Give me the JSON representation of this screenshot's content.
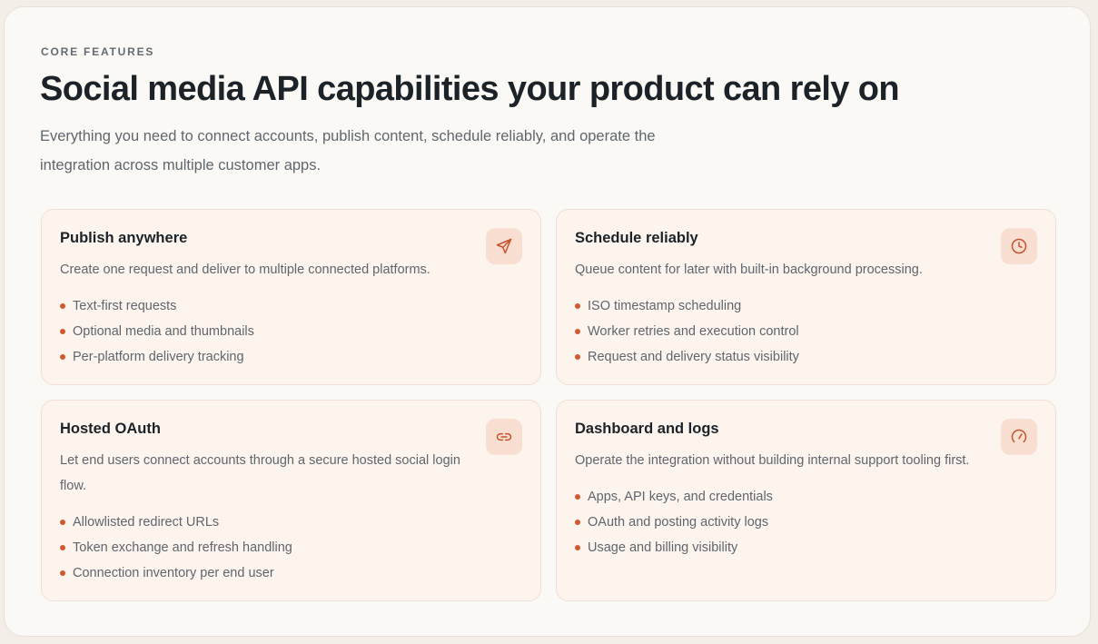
{
  "section": {
    "eyebrow": "CORE FEATURES",
    "title": "Social media API capabilities your product can rely on",
    "intro": "Everything you need to connect accounts, publish content, schedule reliably, and operate the integration across multiple customer apps."
  },
  "colors": {
    "accent": "#d05a30",
    "card_background": "#fdf4ee",
    "icon_badge": "#f8dfd2",
    "heading": "#1c2328",
    "body_text": "#5f666d"
  },
  "cards": [
    {
      "title": "Publish anywhere",
      "description": "Create one request and deliver to multiple connected platforms.",
      "icon": "send-icon",
      "bullets": [
        "Text-first requests",
        "Optional media and thumbnails",
        "Per-platform delivery tracking"
      ]
    },
    {
      "title": "Schedule reliably",
      "description": "Queue content for later with built-in background processing.",
      "icon": "clock-icon",
      "bullets": [
        "ISO timestamp scheduling",
        "Worker retries and execution control",
        "Request and delivery status visibility"
      ]
    },
    {
      "title": "Hosted OAuth",
      "description": "Let end users connect accounts through a secure hosted social login flow.",
      "icon": "link-icon",
      "bullets": [
        "Allowlisted redirect URLs",
        "Token exchange and refresh handling",
        "Connection inventory per end user"
      ]
    },
    {
      "title": "Dashboard and logs",
      "description": "Operate the integration without building internal support tooling first.",
      "icon": "gauge-icon",
      "bullets": [
        "Apps, API keys, and credentials",
        "OAuth and posting activity logs",
        "Usage and billing visibility"
      ]
    }
  ]
}
